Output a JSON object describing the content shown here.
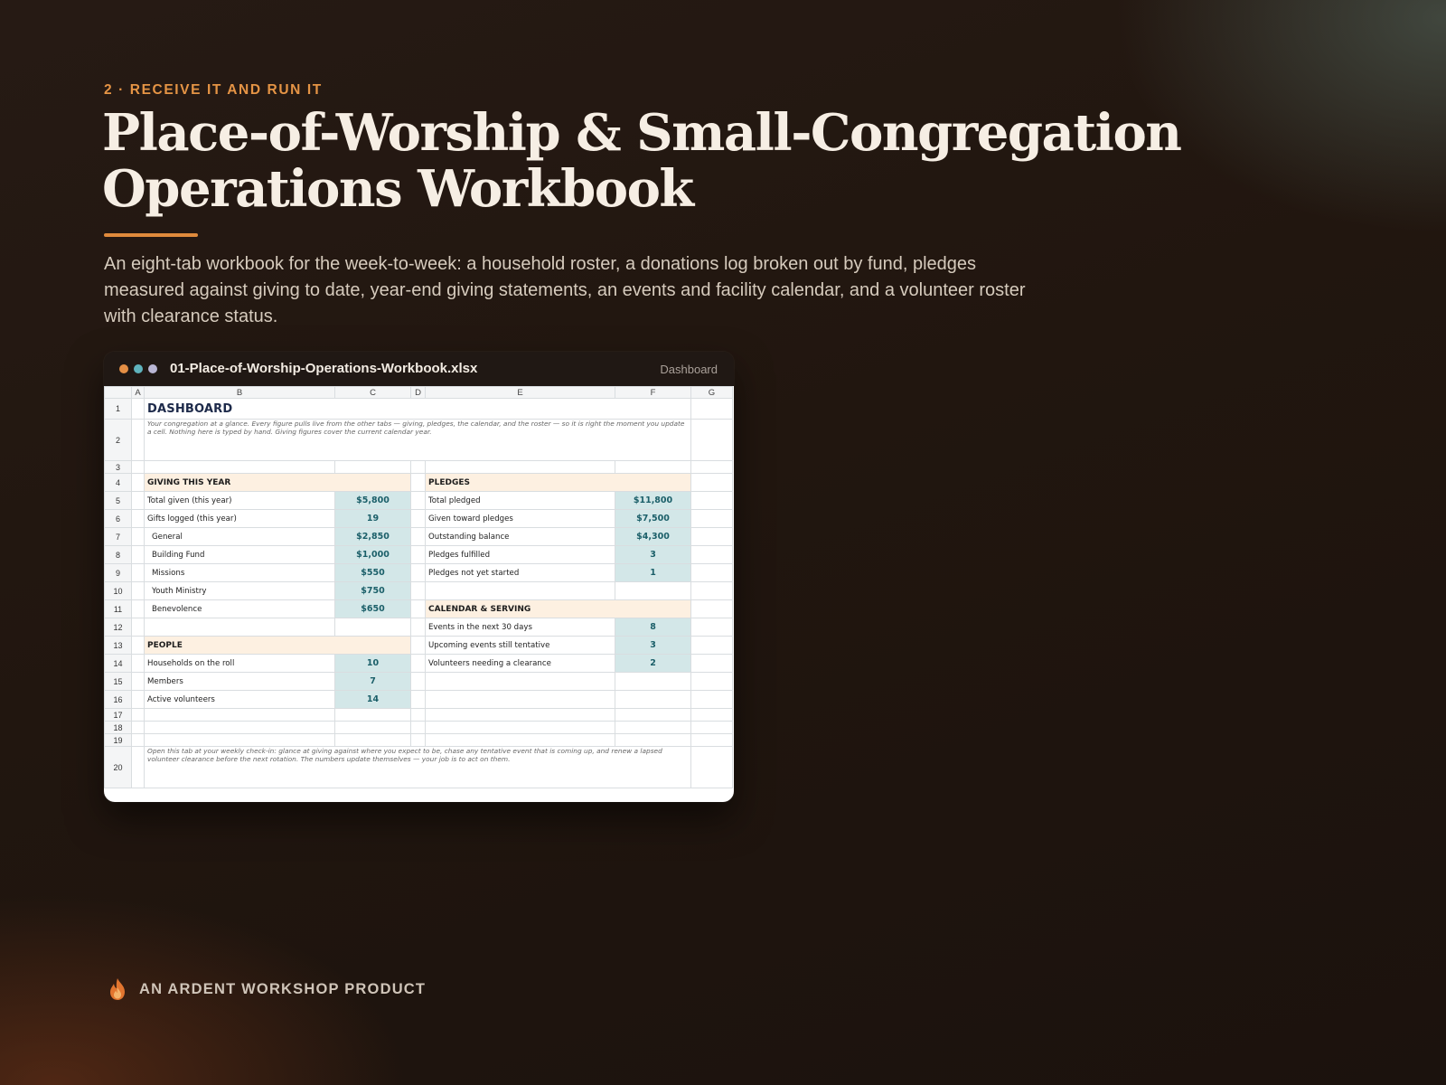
{
  "hero": {
    "eyebrow": "2 · RECEIVE IT AND RUN IT",
    "title": "Place-of-Worship & Small-Congregation Operations Workbook",
    "description": "An eight-tab workbook for the week-to-week: a household roster, a donations log broken out by fund, pledges measured against giving to date, year-end giving statements, an events and facility calendar, and a volunteer roster with clearance status."
  },
  "window": {
    "filename": "01-Place-of-Worship-Operations-Workbook.xlsx",
    "tab": "Dashboard",
    "dot_colors": [
      "#e58f45",
      "#5fb3bd",
      "#b9b6d4"
    ]
  },
  "sheet": {
    "columns": [
      "A",
      "B",
      "C",
      "D",
      "E",
      "F",
      "G"
    ],
    "rows": [
      "1",
      "2",
      "3",
      "4",
      "5",
      "6",
      "7",
      "8",
      "9",
      "10",
      "11",
      "12",
      "13",
      "14",
      "15",
      "16",
      "17",
      "18",
      "19",
      "20"
    ],
    "title": "DASHBOARD",
    "intro": "Your congregation at a glance. Every figure pulls live from the other tabs — giving, pledges, the calendar, and the roster — so it is right the moment you update a cell. Nothing here is typed by hand. Giving figures cover the current calendar year.",
    "giving": {
      "heading": "GIVING THIS YEAR",
      "rows": [
        {
          "label": "Total given (this year)",
          "value": "$5,800"
        },
        {
          "label": "Gifts logged (this year)",
          "value": "19"
        },
        {
          "label": "General",
          "value": "$2,850"
        },
        {
          "label": "Building Fund",
          "value": "$1,000"
        },
        {
          "label": "Missions",
          "value": "$550"
        },
        {
          "label": "Youth Ministry",
          "value": "$750"
        },
        {
          "label": "Benevolence",
          "value": "$650"
        }
      ]
    },
    "pledges": {
      "heading": "PLEDGES",
      "rows": [
        {
          "label": "Total pledged",
          "value": "$11,800"
        },
        {
          "label": "Given toward pledges",
          "value": "$7,500"
        },
        {
          "label": "Outstanding balance",
          "value": "$4,300"
        },
        {
          "label": "Pledges fulfilled",
          "value": "3"
        },
        {
          "label": "Pledges not yet started",
          "value": "1"
        }
      ]
    },
    "calendar": {
      "heading": "CALENDAR & SERVING",
      "rows": [
        {
          "label": "Events in the next 30 days",
          "value": "8"
        },
        {
          "label": "Upcoming events still tentative",
          "value": "3"
        },
        {
          "label": "Volunteers needing a clearance",
          "value": "2"
        }
      ]
    },
    "people": {
      "heading": "PEOPLE",
      "rows": [
        {
          "label": "Households on the roll",
          "value": "10"
        },
        {
          "label": "Members",
          "value": "7"
        },
        {
          "label": "Active volunteers",
          "value": "14"
        }
      ]
    },
    "footnote": "Open this tab at your weekly check-in: glance at giving against where you expect to be, chase any tentative event that is coming up, and renew a lapsed volunteer clearance before the next rotation. The numbers update themselves — your job is to act on them."
  },
  "footer": {
    "brand": "AN ARDENT WORKSHOP PRODUCT",
    "icon": "flame-icon"
  },
  "colors": {
    "accent": "#e59445",
    "section_fill": "#fdf0e1",
    "value_fill": "#d3e7e8",
    "value_text": "#1b5f69"
  }
}
